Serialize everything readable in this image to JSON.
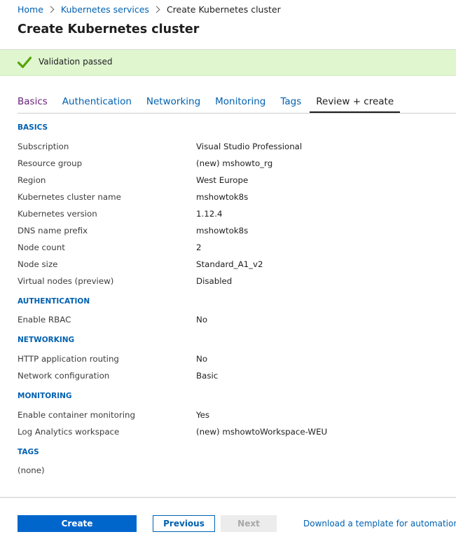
{
  "breadcrumb": {
    "items": [
      "Home",
      "Kubernetes services"
    ],
    "current": "Create Kubernetes cluster"
  },
  "page_title": "Create Kubernetes cluster",
  "validation": {
    "text": "Validation passed",
    "color": "#dff6cf",
    "icon": "checkmark-icon"
  },
  "tabs": [
    {
      "label": "Basics"
    },
    {
      "label": "Authentication"
    },
    {
      "label": "Networking"
    },
    {
      "label": "Monitoring"
    },
    {
      "label": "Tags"
    },
    {
      "label": "Review + create"
    }
  ],
  "sections": {
    "basics": {
      "heading": "BASICS",
      "rows": [
        {
          "label": "Subscription",
          "value": "Visual Studio Professional"
        },
        {
          "label": "Resource group",
          "value": "(new) mshowto_rg"
        },
        {
          "label": "Region",
          "value": "West Europe"
        },
        {
          "label": "Kubernetes cluster name",
          "value": "mshowtok8s"
        },
        {
          "label": "Kubernetes version",
          "value": "1.12.4"
        },
        {
          "label": "DNS name prefix",
          "value": "mshowtok8s"
        },
        {
          "label": "Node count",
          "value": "2"
        },
        {
          "label": "Node size",
          "value": "Standard_A1_v2"
        },
        {
          "label": "Virtual nodes (preview)",
          "value": "Disabled"
        }
      ]
    },
    "authentication": {
      "heading": "AUTHENTICATION",
      "rows": [
        {
          "label": "Enable RBAC",
          "value": "No"
        }
      ]
    },
    "networking": {
      "heading": "NETWORKING",
      "rows": [
        {
          "label": "HTTP application routing",
          "value": "No"
        },
        {
          "label": "Network configuration",
          "value": "Basic"
        }
      ]
    },
    "monitoring": {
      "heading": "MONITORING",
      "rows": [
        {
          "label": "Enable container monitoring",
          "value": "Yes"
        },
        {
          "label": "Log Analytics workspace",
          "value": "(new) mshowtoWorkspace-WEU"
        }
      ]
    },
    "tags": {
      "heading": "TAGS",
      "none_text": "(none)"
    }
  },
  "footer": {
    "create_label": "Create",
    "previous_label": "Previous",
    "next_label": "Next",
    "download_link": "Download a template for automation"
  },
  "colors": {
    "accent": "#0060b0",
    "primary_button": "#0066cc",
    "visited_tab": "#68217a"
  }
}
